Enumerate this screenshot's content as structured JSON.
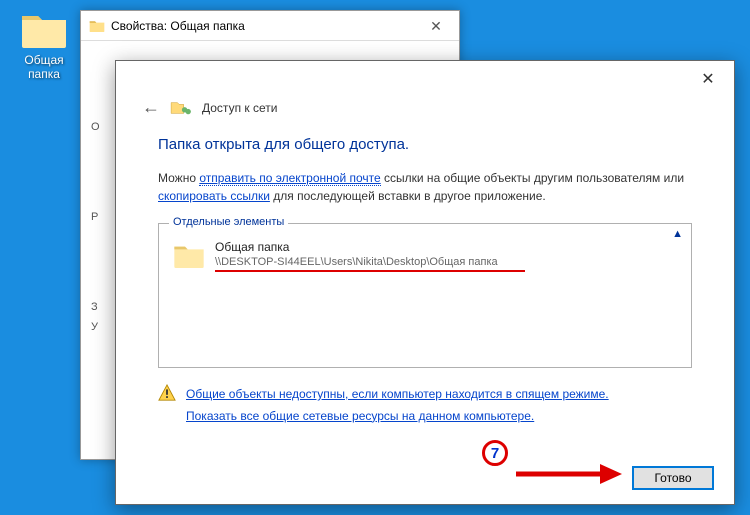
{
  "desktop": {
    "icon_label": "Общая папка"
  },
  "properties_window": {
    "title": "Свойства: Общая папка",
    "letter1": "О",
    "letter2": "Р",
    "letter3": "З",
    "letter4": "У"
  },
  "share_window": {
    "header_title": "Доступ к сети",
    "heading": "Папка открыта для общего доступа.",
    "body_prefix": "Можно ",
    "link_email": "отправить по электронной почте",
    "body_mid": " ссылки на общие объекты другим пользователям или ",
    "link_copy": "скопировать ссылки",
    "body_suffix": " для последующей вставки в другое приложение.",
    "groupbox_title": "Отдельные элементы",
    "collapse_glyph": "▲",
    "folder_name": "Общая папка",
    "folder_path": "\\\\DESKTOP-SI44EEL\\Users\\Nikita\\Desktop\\Общая папка",
    "warn_link1": "Общие объекты недоступны, если компьютер находится в спящем режиме.",
    "warn_link2": "Показать все общие сетевые ресурсы на данном компьютере.",
    "done_button": "Готово"
  },
  "annotation": {
    "number": "7"
  }
}
